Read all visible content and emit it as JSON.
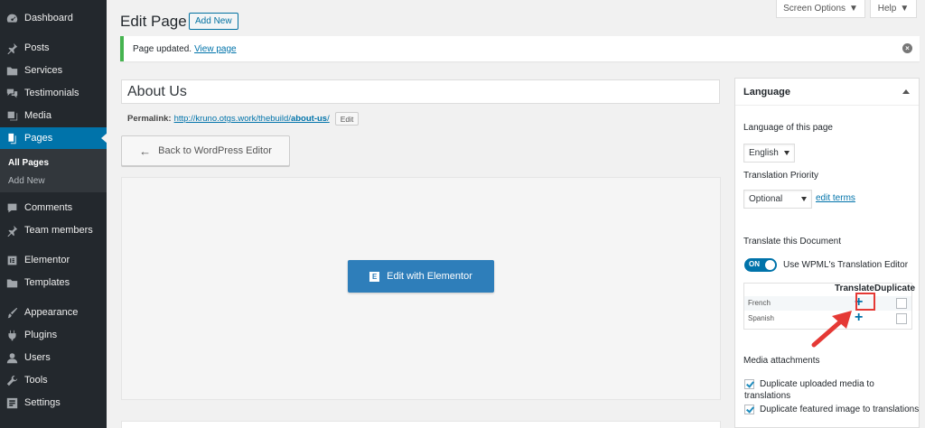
{
  "sidebar": {
    "items": [
      {
        "label": "Dashboard",
        "icon": "dashboard-icon"
      },
      {
        "label": "Posts",
        "icon": "pin-icon"
      },
      {
        "label": "Services",
        "icon": "folder-icon"
      },
      {
        "label": "Testimonials",
        "icon": "comments-icon"
      },
      {
        "label": "Media",
        "icon": "media-icon"
      },
      {
        "label": "Pages",
        "icon": "pages-icon"
      },
      {
        "label": "Comments",
        "icon": "comment-icon"
      },
      {
        "label": "Team members",
        "icon": "pin-icon"
      },
      {
        "label": "Elementor",
        "icon": "elementor-icon"
      },
      {
        "label": "Templates",
        "icon": "folder-icon"
      },
      {
        "label": "Appearance",
        "icon": "brush-icon"
      },
      {
        "label": "Plugins",
        "icon": "plug-icon"
      },
      {
        "label": "Users",
        "icon": "user-icon"
      },
      {
        "label": "Tools",
        "icon": "wrench-icon"
      },
      {
        "label": "Settings",
        "icon": "settings-icon"
      }
    ],
    "submenu": [
      "All Pages",
      "Add New"
    ]
  },
  "top_tabs": {
    "screen_options": "Screen Options",
    "help": "Help"
  },
  "header": {
    "title": "Edit Page",
    "add_new": "Add New"
  },
  "notice": {
    "text": "Page updated.",
    "link": "View page"
  },
  "editor": {
    "title_value": "About Us",
    "permalink_label": "Permalink:",
    "permalink_base": "http://kruno.otgs.work/thebuild/",
    "permalink_slug": "about-us",
    "permalink_trail": "/",
    "edit_slug": "Edit",
    "back_button": "Back to WordPress Editor",
    "elementor_button": "Edit with Elementor",
    "elementor_logo": "E"
  },
  "language_box": {
    "heading": "Language",
    "lang_label": "Language of this page",
    "lang_value": "English",
    "priority_label": "Translation Priority",
    "priority_value": "Optional",
    "edit_terms": "edit terms",
    "translate_heading": "Translate this Document",
    "toggle_state": "ON",
    "toggle_label": "Use WPML's Translation Editor",
    "col_translate": "Translate",
    "col_duplicate": "Duplicate",
    "languages": [
      "French",
      "Spanish"
    ],
    "plus": "+",
    "media_heading": "Media attachments",
    "media_opt1": "Duplicate uploaded media to translations",
    "media_opt2": "Duplicate featured image to translations"
  },
  "colors": {
    "accent": "#0073aa",
    "sidebar_bg": "#23282d",
    "notice_green": "#46b450",
    "elementor_blue": "#2e7eba",
    "highlight_red": "#e53935"
  }
}
